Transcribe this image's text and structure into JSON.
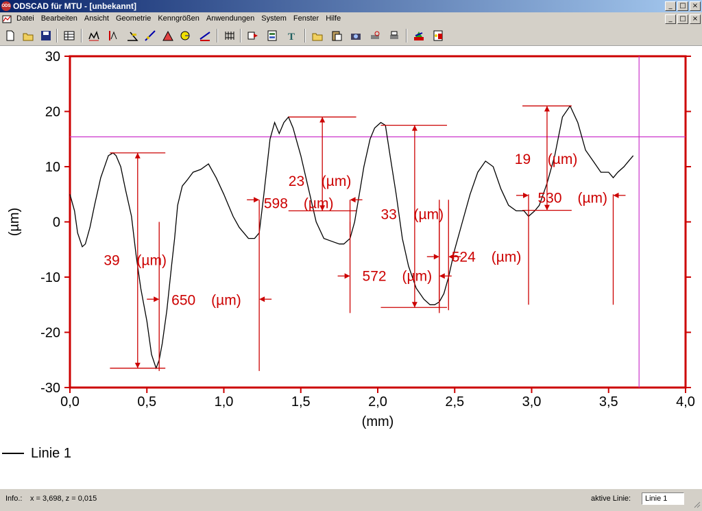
{
  "window": {
    "title": "ODSCAD für MTU - [unbekannt]",
    "app_badge": "ODS",
    "controls": [
      "_",
      "□",
      "×"
    ]
  },
  "menu": [
    "Datei",
    "Bearbeiten",
    "Ansicht",
    "Geometrie",
    "Kenngrößen",
    "Anwendungen",
    "System",
    "Fenster",
    "Hilfe"
  ],
  "toolbar": [
    "new-file-icon",
    "open-file-icon",
    "save-icon",
    "table-icon",
    "measure-profile-icon",
    "measure-height-icon",
    "measure-angle-icon",
    "measure-slope-icon",
    "measure-triangle-icon",
    "radius-icon",
    "line-fit-icon",
    "grid-icon",
    "export-icon",
    "report-icon",
    "text-icon",
    "folder-open-icon",
    "paste-icon",
    "camera-icon",
    "print-preview-icon",
    "print-icon",
    "color-icon",
    "settings-icon"
  ],
  "legend": {
    "label": "Linie 1"
  },
  "statusbar": {
    "info_label": "Info.:",
    "info_value": "x = 3,698, z = 0,015",
    "active_line_label": "aktive Linie:",
    "active_line_value": "Linie 1"
  },
  "chart_data": {
    "type": "line",
    "xlabel": "(mm)",
    "ylabel": "(µm)",
    "xlim": [
      0,
      4
    ],
    "ylim": [
      -30,
      30
    ],
    "xticks": [
      "0,0",
      "0,5",
      "1,0",
      "1,5",
      "2,0",
      "2,5",
      "3,0",
      "3,5",
      "4,0"
    ],
    "yticks": [
      "30",
      "20",
      "10",
      "0",
      "-10",
      "-20",
      "-30"
    ],
    "cursor": {
      "x": 3.698,
      "z": 15.4
    },
    "series": [
      {
        "name": "Linie 1",
        "x": [
          0.0,
          0.03,
          0.05,
          0.08,
          0.1,
          0.13,
          0.16,
          0.2,
          0.25,
          0.28,
          0.3,
          0.33,
          0.36,
          0.4,
          0.43,
          0.46,
          0.5,
          0.53,
          0.56,
          0.58,
          0.6,
          0.63,
          0.66,
          0.68,
          0.7,
          0.73,
          0.76,
          0.8,
          0.85,
          0.9,
          0.95,
          1.0,
          1.03,
          1.06,
          1.1,
          1.13,
          1.16,
          1.2,
          1.23,
          1.26,
          1.28,
          1.3,
          1.33,
          1.36,
          1.39,
          1.42,
          1.45,
          1.47,
          1.5,
          1.55,
          1.6,
          1.65,
          1.7,
          1.75,
          1.78,
          1.82,
          1.85,
          1.88,
          1.91,
          1.95,
          1.98,
          2.02,
          2.05,
          2.08,
          2.12,
          2.16,
          2.2,
          2.25,
          2.3,
          2.34,
          2.37,
          2.4,
          2.43,
          2.46,
          2.5,
          2.55,
          2.6,
          2.65,
          2.7,
          2.75,
          2.8,
          2.85,
          2.9,
          2.95,
          2.98,
          3.02,
          3.05,
          3.1,
          3.15,
          3.2,
          3.25,
          3.3,
          3.35,
          3.4,
          3.45,
          3.5,
          3.53,
          3.56,
          3.6,
          3.63,
          3.66
        ],
        "y": [
          5,
          2,
          -2,
          -4.5,
          -4,
          -1,
          3,
          8,
          12,
          12.5,
          12,
          10,
          6,
          1,
          -6,
          -12,
          -18,
          -24,
          -26.5,
          -25,
          -22,
          -16,
          -8,
          -3,
          3,
          6.5,
          7.5,
          9,
          9.5,
          10.5,
          8,
          5,
          3,
          1,
          -1,
          -2,
          -3,
          -3,
          -2,
          5,
          10,
          15,
          18,
          16,
          18,
          19,
          17,
          15,
          12,
          6,
          0,
          -3,
          -3.5,
          -4,
          -4,
          -3,
          0,
          5,
          10,
          15,
          17,
          18,
          17.5,
          12,
          5,
          -3,
          -8,
          -12,
          -14,
          -15,
          -15,
          -14.5,
          -13,
          -10,
          -5,
          0,
          5,
          9,
          11,
          10,
          6,
          3,
          2,
          2,
          1,
          2,
          3,
          7,
          12,
          19,
          21,
          18,
          13,
          11,
          9,
          9,
          8,
          9,
          10,
          11,
          12
        ],
        "color": "#000000"
      }
    ],
    "annotations": [
      {
        "value": "39",
        "unit": "(µm)",
        "kind": "height"
      },
      {
        "value": "650",
        "unit": "(µm)",
        "kind": "width"
      },
      {
        "value": "598",
        "unit": "(µm)",
        "kind": "width"
      },
      {
        "value": "23",
        "unit": "(µm)",
        "kind": "height"
      },
      {
        "value": "572",
        "unit": "(µm)",
        "kind": "width"
      },
      {
        "value": "33",
        "unit": "(µm)",
        "kind": "height"
      },
      {
        "value": "524",
        "unit": "(µm)",
        "kind": "width"
      },
      {
        "value": "19",
        "unit": "(µm)",
        "kind": "height"
      },
      {
        "value": "530",
        "unit": "(µm)",
        "kind": "width"
      }
    ],
    "frame_color": "#cc0000",
    "annotation_color": "#cc0000",
    "cursor_color": "#cc33cc"
  }
}
